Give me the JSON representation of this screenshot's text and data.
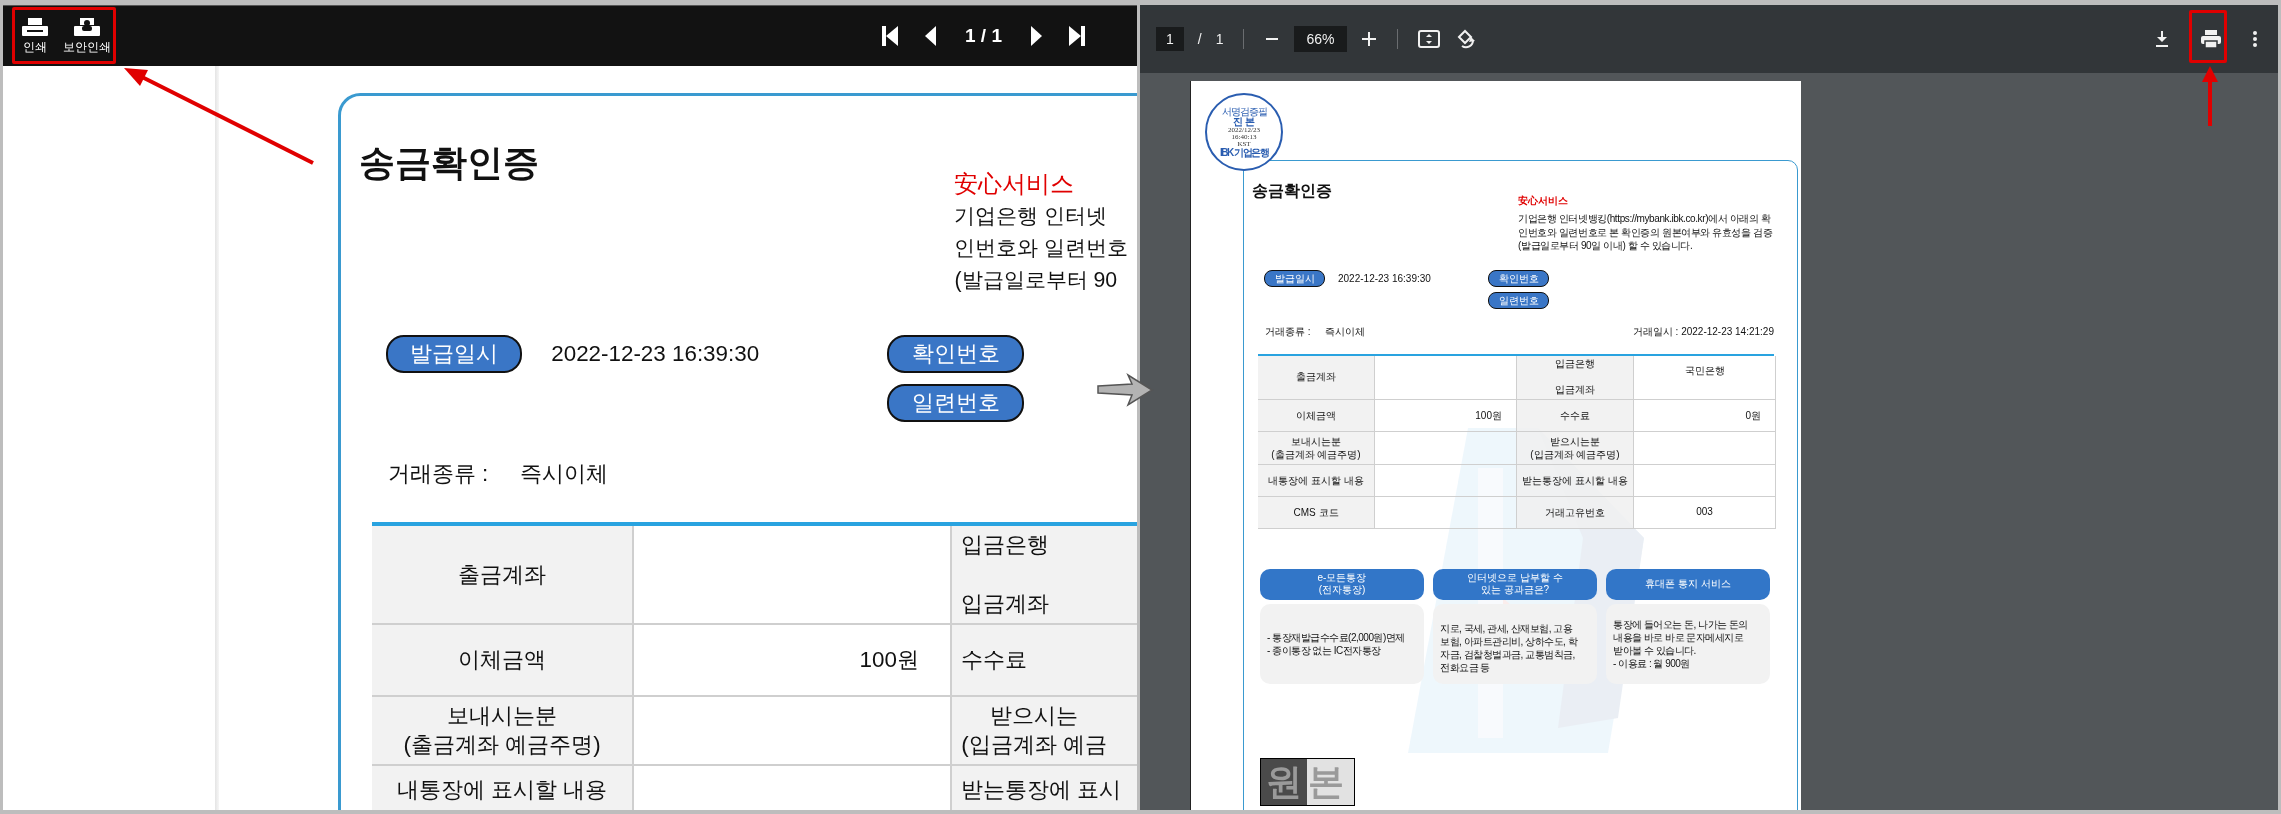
{
  "left_viewer": {
    "toolbar": {
      "buttons": [
        {
          "kind": "print",
          "label": "인쇄"
        },
        {
          "kind": "secure_print",
          "label": "보안인쇄"
        }
      ],
      "page_status": "1 / 1"
    },
    "document": {
      "title": "송금확인증",
      "notice_heading": "安心서비스",
      "notice": "기업은행 인터넷\n인번호와 일련번호\n(발급일로부터 90",
      "issue": {
        "label": "발급일시",
        "value": "2022-12-23 16:39:30"
      },
      "verification": [
        {
          "label": "확인번호"
        },
        {
          "label": "일련번호"
        }
      ],
      "transaction_type": {
        "label": "거래종류 :",
        "value": "즉시이체"
      },
      "table": {
        "rows": [
          [
            {
              "kind": "label",
              "text": "출금계좌"
            },
            {
              "kind": "value"
            },
            {
              "kind": "label",
              "text": "입금은행\n입금계좌"
            }
          ],
          [
            {
              "kind": "label",
              "text": "이체금액"
            },
            {
              "kind": "amount",
              "text": "100원"
            },
            {
              "kind": "label",
              "text": "수수료"
            }
          ],
          [
            {
              "kind": "label",
              "text": "보내시는분\n(출금계좌 예금주명)"
            },
            {
              "kind": "value"
            },
            {
              "kind": "label",
              "text": "받으시는\n(입금계좌 예금"
            }
          ],
          [
            {
              "kind": "label",
              "text": "내통장에 표시할 내용"
            },
            {
              "kind": "value"
            },
            {
              "kind": "label",
              "text": "받는통장에 표시"
            }
          ]
        ]
      }
    }
  },
  "right_viewer": {
    "toolbar": {
      "page_input": "1",
      "page_separator": "/",
      "page_count": "1",
      "zoom": "66%"
    },
    "document": {
      "stamp": {
        "arc_text": "서명검증필",
        "title": "진 본",
        "date": "2022/12/23",
        "time": "16:40:13",
        "zone": "KST",
        "issuer": "IBK 기업은행"
      },
      "title": "송금확인증",
      "notice_heading": "安心서비스",
      "notice": "기업은행 인터넷뱅킹(https://mybank.ibk.co.kr)에서 아래의 확\n인번호와 일련번호로 본 확인증의 원본여부와 유효성을 검증\n(발급일로부터 90일 이내) 할 수 있습니다.",
      "issue": {
        "label": "발급일시",
        "value": "2022-12-23 16:39:30"
      },
      "verification": [
        {
          "label": "확인번호"
        },
        {
          "label": "일련번호"
        }
      ],
      "transaction_type": {
        "label": "거래종류 :",
        "value": "즉시이체"
      },
      "transaction_time": "거래일시 : 2022-12-23 14:21:29",
      "background_logo": true,
      "table": {
        "rows": [
          [
            {
              "kind": "label",
              "text": "출금계좌"
            },
            {
              "kind": "value"
            },
            {
              "kind": "label",
              "text": "입금은행\n입금계좌"
            },
            {
              "kind": "value",
              "text": "국민은행"
            }
          ],
          [
            {
              "kind": "label",
              "text": "이체금액"
            },
            {
              "kind": "amount",
              "text": "100원"
            },
            {
              "kind": "label",
              "text": "수수료"
            },
            {
              "kind": "amount",
              "text": "0원"
            }
          ],
          [
            {
              "kind": "label",
              "text": "보내시는분\n(출금계좌 예금주명)"
            },
            {
              "kind": "value"
            },
            {
              "kind": "label",
              "text": "받으시는분\n(입금계좌 예금주명)"
            },
            {
              "kind": "value"
            }
          ],
          [
            {
              "kind": "label",
              "text": "내통장에 표시할 내용"
            },
            {
              "kind": "value"
            },
            {
              "kind": "label",
              "text": "받는통장에 표시할 내용"
            },
            {
              "kind": "value"
            }
          ],
          [
            {
              "kind": "label",
              "text": "CMS 코드"
            },
            {
              "kind": "value"
            },
            {
              "kind": "label",
              "text": "거래고유번호"
            },
            {
              "kind": "value",
              "text": "003"
            }
          ]
        ]
      },
      "services": [
        {
          "title": "e-모든통장\n(전자통장)",
          "body": "- 통장재발급수수료(2,000원)면제\n- 종이통장 없는 IC전자통장"
        },
        {
          "title": "인터넷으로 납부할 수\n있는 공과금은?",
          "body": "지로, 국세, 관세, 산재보험, 고용\n보험, 아파트관리비, 상하수도, 학\n자금, 검찰청벌과금, 교통범칙금,\n전화요금 등"
        },
        {
          "title": "휴대폰 통지 서비스",
          "body": "통장에 들어오는 돈, 나가는 돈의\n내용을 바로 바로 문자메세지로\n받아볼 수 있습니다.\n- 이용료 : 월 900원"
        }
      ],
      "original_mark": "원본"
    }
  },
  "annotations": [
    {
      "kind": "left_print_frame"
    },
    {
      "kind": "left_print_arrow"
    },
    {
      "kind": "transition_arrow"
    },
    {
      "kind": "right_print_frame"
    },
    {
      "kind": "right_print_arrow"
    }
  ]
}
